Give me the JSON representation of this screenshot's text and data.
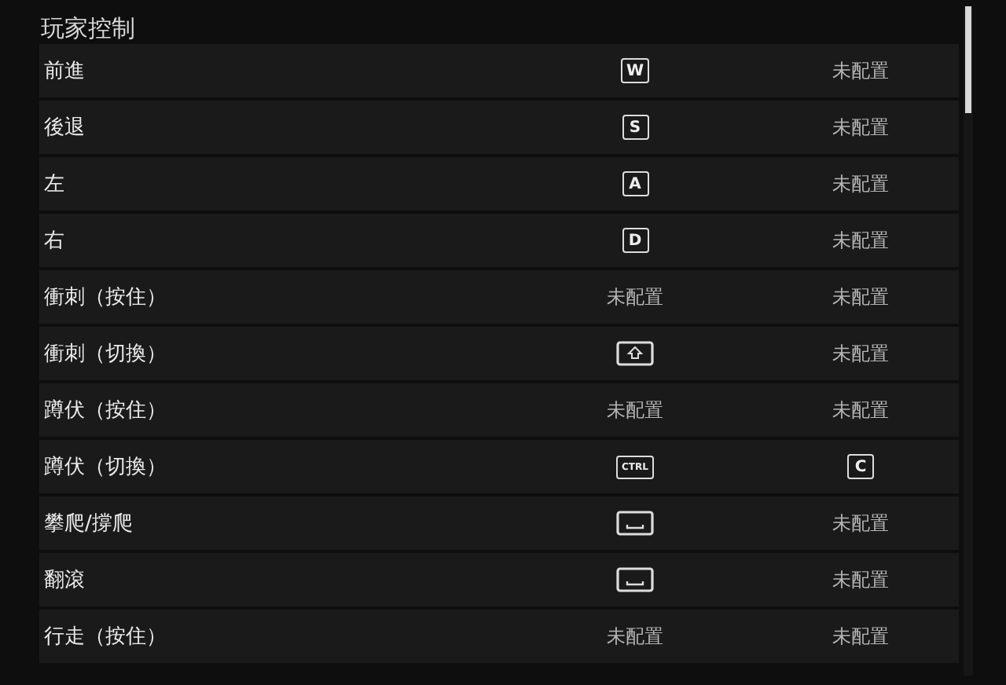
{
  "section_title": "玩家控制",
  "rows": [
    {
      "action": "前進",
      "primary": {
        "kind": "key",
        "label": "W"
      },
      "secondary": {
        "kind": "none",
        "label": "未配置"
      }
    },
    {
      "action": "後退",
      "primary": {
        "kind": "key",
        "label": "S"
      },
      "secondary": {
        "kind": "none",
        "label": "未配置"
      }
    },
    {
      "action": "左",
      "primary": {
        "kind": "key",
        "label": "A"
      },
      "secondary": {
        "kind": "none",
        "label": "未配置"
      }
    },
    {
      "action": "右",
      "primary": {
        "kind": "key",
        "label": "D"
      },
      "secondary": {
        "kind": "none",
        "label": "未配置"
      }
    },
    {
      "action": "衝刺（按住）",
      "primary": {
        "kind": "none",
        "label": "未配置"
      },
      "secondary": {
        "kind": "none",
        "label": "未配置"
      }
    },
    {
      "action": "衝刺（切換）",
      "primary": {
        "kind": "shift"
      },
      "secondary": {
        "kind": "none",
        "label": "未配置"
      }
    },
    {
      "action": "蹲伏（按住）",
      "primary": {
        "kind": "none",
        "label": "未配置"
      },
      "secondary": {
        "kind": "none",
        "label": "未配置"
      }
    },
    {
      "action": "蹲伏（切換）",
      "primary": {
        "kind": "wide",
        "label": "CTRL"
      },
      "secondary": {
        "kind": "key",
        "label": "C"
      }
    },
    {
      "action": "攀爬/撐爬",
      "primary": {
        "kind": "space"
      },
      "secondary": {
        "kind": "none",
        "label": "未配置"
      }
    },
    {
      "action": "翻滾",
      "primary": {
        "kind": "space"
      },
      "secondary": {
        "kind": "none",
        "label": "未配置"
      }
    },
    {
      "action": "行走（按住）",
      "primary": {
        "kind": "none",
        "label": "未配置"
      },
      "secondary": {
        "kind": "none",
        "label": "未配置"
      }
    }
  ]
}
